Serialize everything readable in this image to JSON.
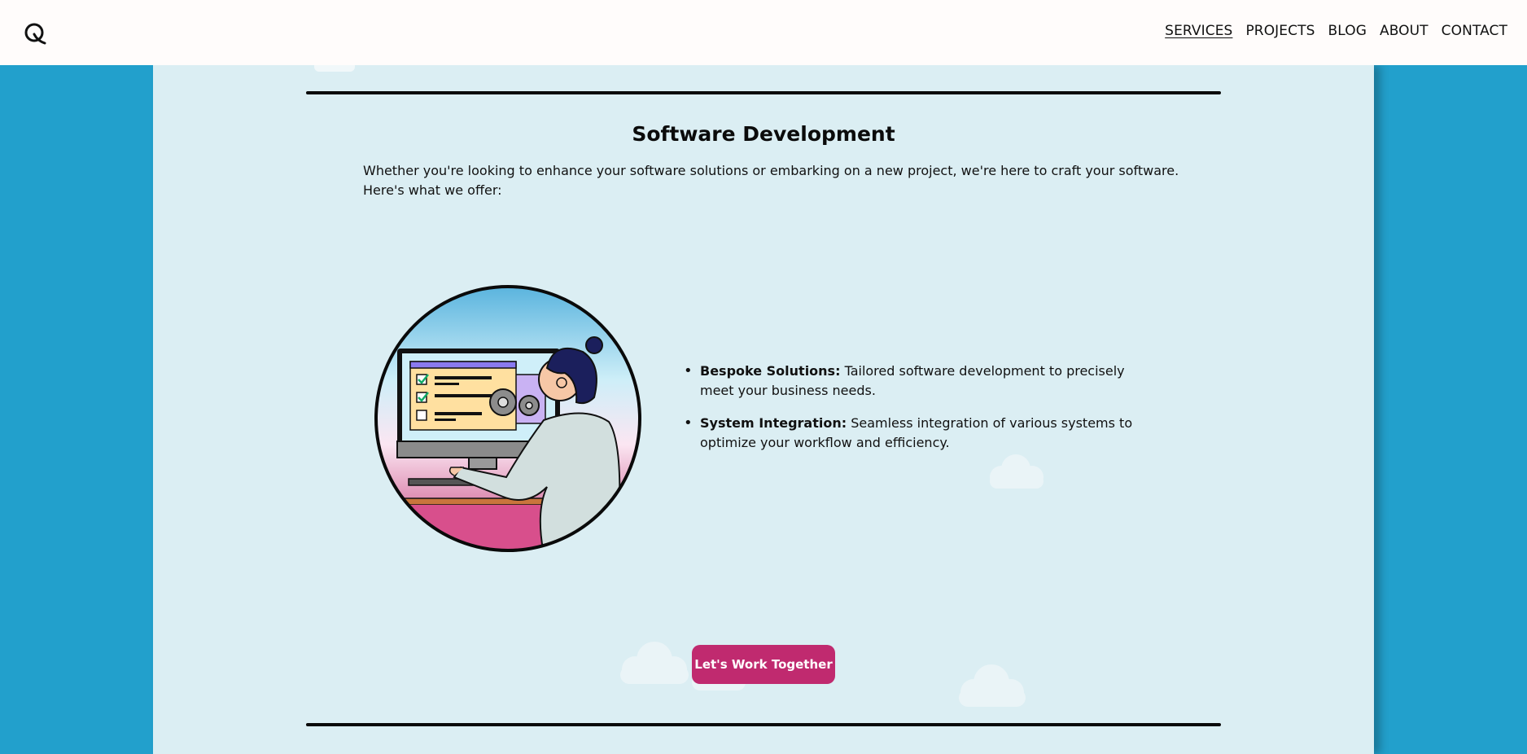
{
  "nav": {
    "items": [
      {
        "label": "SERVICES",
        "active": true
      },
      {
        "label": "PROJECTS"
      },
      {
        "label": "BLOG"
      },
      {
        "label": "ABOUT"
      },
      {
        "label": "CONTACT"
      }
    ]
  },
  "logo": {
    "icon": "q-logo-icon"
  },
  "section": {
    "title": "Software Development",
    "intro": "Whether you're looking to enhance your software solutions or embarking on a new project, we're here to craft your software. Here's what we offer:",
    "bullets": [
      {
        "heading": "Bespoke Solutions:",
        "text": " Tailored software development to precisely meet your business needs."
      },
      {
        "heading": "System Integration:",
        "text": " Seamless integration of various systems to optimize your workflow and efficiency."
      }
    ],
    "cta_label": "Let's Work Together"
  },
  "colors": {
    "background": "#22a0cc",
    "panel": "#dbeef3",
    "accent": "#c02a6f",
    "rule": "#0a0a0a"
  }
}
